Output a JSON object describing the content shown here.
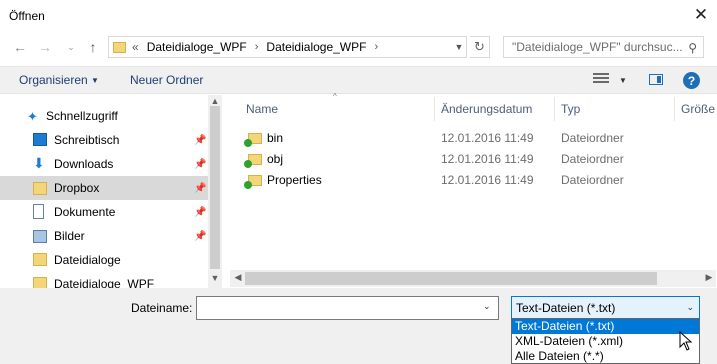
{
  "window": {
    "title": "Öffnen"
  },
  "address": {
    "overflow": "«",
    "crumbs": [
      "Dateidialoge_WPF",
      "Dateidialoge_WPF"
    ],
    "search_placeholder": "\"Dateidialoge_WPF\" durchsuc..."
  },
  "toolbar": {
    "organize": "Organisieren",
    "new_folder": "Neuer Ordner"
  },
  "sidebar": {
    "items": [
      {
        "label": "Schnellzugriff",
        "icon": "star-icon",
        "pinned": false
      },
      {
        "label": "Schreibtisch",
        "icon": "desktop-icon",
        "pinned": true
      },
      {
        "label": "Downloads",
        "icon": "download-icon",
        "pinned": true
      },
      {
        "label": "Dropbox",
        "icon": "dropbox-folder-icon",
        "pinned": true,
        "selected": true
      },
      {
        "label": "Dokumente",
        "icon": "document-icon",
        "pinned": true
      },
      {
        "label": "Bilder",
        "icon": "pictures-icon",
        "pinned": true
      },
      {
        "label": "Dateidialoge",
        "icon": "folder-icon",
        "pinned": false
      },
      {
        "label": "Dateidialoge_WPF",
        "icon": "folder-icon",
        "pinned": false
      }
    ]
  },
  "columns": {
    "name": "Name",
    "date": "Änderungsdatum",
    "type": "Typ",
    "size": "Größe"
  },
  "files": [
    {
      "name": "bin",
      "date": "12.01.2016 11:49",
      "type": "Dateiordner"
    },
    {
      "name": "obj",
      "date": "12.01.2016 11:49",
      "type": "Dateiordner"
    },
    {
      "name": "Properties",
      "date": "12.01.2016 11:49",
      "type": "Dateiordner"
    }
  ],
  "bottom": {
    "filename_label": "Dateiname:",
    "filename_value": "",
    "filter_selected": "Text-Dateien (*.txt)",
    "filter_options": [
      "Text-Dateien (*.txt)",
      "XML-Dateien (*.xml)",
      "Alle Dateien (*.*)"
    ]
  },
  "colors": {
    "accent": "#0078d7",
    "selection": "#d9d9d9",
    "header_text": "#4c607a"
  }
}
